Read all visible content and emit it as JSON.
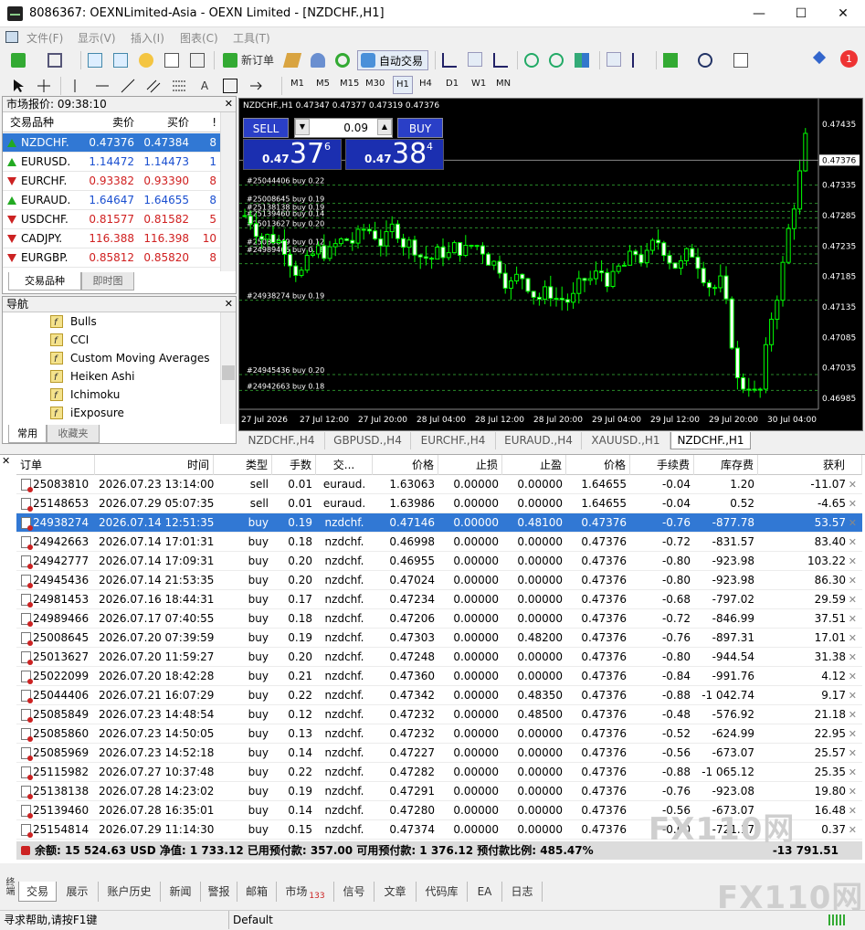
{
  "window": {
    "title": "8086367: OEXNLimited-Asia - OEXN Limited - [NZDCHF.,H1]",
    "min": "—",
    "max": "☐",
    "close": "✕"
  },
  "menu": [
    "文件(F)",
    "显示(V)",
    "插入(I)",
    "图表(C)",
    "工具(T)"
  ],
  "toolbar": {
    "new_order": "新订单",
    "autotrade": "自动交易",
    "timeframes": [
      "M1",
      "M5",
      "M15",
      "M30",
      "H1",
      "H4",
      "D1",
      "W1",
      "MN"
    ],
    "active_tf": "H1",
    "notif_count": "1"
  },
  "market_watch": {
    "title": "市场报价: 09:38:10",
    "headers": {
      "symbol": "交易品种",
      "bid": "卖价",
      "ask": "买价",
      "spread": "!"
    },
    "rows": [
      {
        "symbol": "NZDCHF.",
        "bid": "0.47376",
        "ask": "0.47384",
        "spread": "8",
        "dir": "up",
        "sel": true
      },
      {
        "symbol": "EURUSD.",
        "bid": "1.14472",
        "ask": "1.14473",
        "spread": "1",
        "dir": "up"
      },
      {
        "symbol": "EURCHF.",
        "bid": "0.93382",
        "ask": "0.93390",
        "spread": "8",
        "dir": "down"
      },
      {
        "symbol": "EURAUD.",
        "bid": "1.64647",
        "ask": "1.64655",
        "spread": "8",
        "dir": "up"
      },
      {
        "symbol": "USDCHF.",
        "bid": "0.81577",
        "ask": "0.81582",
        "spread": "5",
        "dir": "down"
      },
      {
        "symbol": "CADJPY.",
        "bid": "116.388",
        "ask": "116.398",
        "spread": "10",
        "dir": "down"
      },
      {
        "symbol": "EURGBP.",
        "bid": "0.85812",
        "ask": "0.85820",
        "spread": "8",
        "dir": "down"
      }
    ],
    "tabs": [
      "交易品种",
      "即时图"
    ]
  },
  "navigator": {
    "title": "导航",
    "items": [
      "Bulls",
      "CCI",
      "Custom Moving Averages",
      "Heiken Ashi",
      "Ichimoku",
      "iExposure"
    ],
    "tabs": [
      "常用",
      "收藏夹"
    ]
  },
  "chart": {
    "header": "NZDCHF.,H1  0.47347 0.47377 0.47319 0.47376",
    "sell": "SELL",
    "buy": "BUY",
    "lot": "0.09",
    "sell_small": "0.47",
    "sell_big": "37",
    "sell_sup": "6",
    "buy_small": "0.47",
    "buy_big": "38",
    "buy_sup": "4",
    "price_ticks": [
      "0.47435",
      "0.47376",
      "0.47335",
      "0.47285",
      "0.47235",
      "0.47185",
      "0.47135",
      "0.47085",
      "0.47035",
      "0.46985"
    ],
    "time_ticks": [
      "27 Jul 2026",
      "27 Jul 12:00",
      "27 Jul 20:00",
      "28 Jul 04:00",
      "28 Jul 12:00",
      "28 Jul 20:00",
      "29 Jul 04:00",
      "29 Jul 12:00",
      "29 Jul 20:00",
      "30 Jul 04:00"
    ],
    "order_labels": [
      "#25044406 buy 0.22",
      "#25008645 buy 0.19",
      "#25138138 buy 0.19",
      "#25139460 buy 0.14",
      "#25013627 buy 0.20",
      "#25085849 buy 0.12",
      "#24989466 buy 0.18",
      "#24938274 buy 0.19",
      "#24945436 buy 0.20",
      "#24942663 buy 0.18"
    ],
    "tabs": [
      "NZDCHF.,H4",
      "GBPUSD.,H4",
      "EURCHF.,H4",
      "EURAUD.,H4",
      "XAUUSD.,H1",
      "NZDCHF.,H1"
    ],
    "active_tab": "NZDCHF.,H1"
  },
  "terminal": {
    "headers": [
      "订单",
      "时间",
      "类型",
      "手数",
      "交...",
      "价格",
      "止损",
      "止盈",
      "价格",
      "手续费",
      "库存费",
      "获利"
    ],
    "rows": [
      [
        "25083810",
        "2026.07.23 13:14:00",
        "sell",
        "0.01",
        "euraud.",
        "1.63063",
        "0.00000",
        "0.00000",
        "1.64655",
        "-0.04",
        "1.20",
        "-11.07"
      ],
      [
        "25148653",
        "2026.07.29 05:07:35",
        "sell",
        "0.01",
        "euraud.",
        "1.63986",
        "0.00000",
        "0.00000",
        "1.64655",
        "-0.04",
        "0.52",
        "-4.65"
      ],
      [
        "24938274",
        "2026.07.14 12:51:35",
        "buy",
        "0.19",
        "nzdchf.",
        "0.47146",
        "0.00000",
        "0.48100",
        "0.47376",
        "-0.76",
        "-877.78",
        "53.57"
      ],
      [
        "24942663",
        "2026.07.14 17:01:31",
        "buy",
        "0.18",
        "nzdchf.",
        "0.46998",
        "0.00000",
        "0.00000",
        "0.47376",
        "-0.72",
        "-831.57",
        "83.40"
      ],
      [
        "24942777",
        "2026.07.14 17:09:31",
        "buy",
        "0.20",
        "nzdchf.",
        "0.46955",
        "0.00000",
        "0.00000",
        "0.47376",
        "-0.80",
        "-923.98",
        "103.22"
      ],
      [
        "24945436",
        "2026.07.14 21:53:35",
        "buy",
        "0.20",
        "nzdchf.",
        "0.47024",
        "0.00000",
        "0.00000",
        "0.47376",
        "-0.80",
        "-923.98",
        "86.30"
      ],
      [
        "24981453",
        "2026.07.16 18:44:31",
        "buy",
        "0.17",
        "nzdchf.",
        "0.47234",
        "0.00000",
        "0.00000",
        "0.47376",
        "-0.68",
        "-797.02",
        "29.59"
      ],
      [
        "24989466",
        "2026.07.17 07:40:55",
        "buy",
        "0.18",
        "nzdchf.",
        "0.47206",
        "0.00000",
        "0.00000",
        "0.47376",
        "-0.72",
        "-846.99",
        "37.51"
      ],
      [
        "25008645",
        "2026.07.20 07:39:59",
        "buy",
        "0.19",
        "nzdchf.",
        "0.47303",
        "0.00000",
        "0.48200",
        "0.47376",
        "-0.76",
        "-897.31",
        "17.01"
      ],
      [
        "25013627",
        "2026.07.20 11:59:27",
        "buy",
        "0.20",
        "nzdchf.",
        "0.47248",
        "0.00000",
        "0.00000",
        "0.47376",
        "-0.80",
        "-944.54",
        "31.38"
      ],
      [
        "25022099",
        "2026.07.20 18:42:28",
        "buy",
        "0.21",
        "nzdchf.",
        "0.47360",
        "0.00000",
        "0.00000",
        "0.47376",
        "-0.84",
        "-991.76",
        "4.12"
      ],
      [
        "25044406",
        "2026.07.21 16:07:29",
        "buy",
        "0.22",
        "nzdchf.",
        "0.47342",
        "0.00000",
        "0.48350",
        "0.47376",
        "-0.88",
        "-1 042.74",
        "9.17"
      ],
      [
        "25085849",
        "2026.07.23 14:48:54",
        "buy",
        "0.12",
        "nzdchf.",
        "0.47232",
        "0.00000",
        "0.48500",
        "0.47376",
        "-0.48",
        "-576.92",
        "21.18"
      ],
      [
        "25085860",
        "2026.07.23 14:50:05",
        "buy",
        "0.13",
        "nzdchf.",
        "0.47232",
        "0.00000",
        "0.00000",
        "0.47376",
        "-0.52",
        "-624.99",
        "22.95"
      ],
      [
        "25085969",
        "2026.07.23 14:52:18",
        "buy",
        "0.14",
        "nzdchf.",
        "0.47227",
        "0.00000",
        "0.00000",
        "0.47376",
        "-0.56",
        "-673.07",
        "25.57"
      ],
      [
        "25115982",
        "2026.07.27 10:37:48",
        "buy",
        "0.22",
        "nzdchf.",
        "0.47282",
        "0.00000",
        "0.00000",
        "0.47376",
        "-0.88",
        "-1 065.12",
        "25.35"
      ],
      [
        "25138138",
        "2026.07.28 14:23:02",
        "buy",
        "0.19",
        "nzdchf.",
        "0.47291",
        "0.00000",
        "0.00000",
        "0.47376",
        "-0.76",
        "-923.08",
        "19.80"
      ],
      [
        "25139460",
        "2026.07.28 16:35:01",
        "buy",
        "0.14",
        "nzdchf.",
        "0.47280",
        "0.00000",
        "0.00000",
        "0.47376",
        "-0.56",
        "-673.07",
        "16.48"
      ],
      [
        "25154814",
        "2026.07.29 11:14:30",
        "buy",
        "0.15",
        "nzdchf.",
        "0.47374",
        "0.00000",
        "0.00000",
        "0.47376",
        "-0.60",
        "-721.17",
        "0.37"
      ]
    ],
    "summary": "余额: 15 524.63 USD  净值: 1 733.12  已用预付款: 357.00  可用预付款: 1 376.12  预付款比例: 485.47%",
    "summary_total": "-13 791.51",
    "tabs": [
      "交易",
      "展示",
      "账户历史",
      "新闻",
      "警报",
      "邮箱",
      "市场",
      "信号",
      "文章",
      "代码库",
      "EA",
      "日志"
    ],
    "market_badge": "133"
  },
  "statusbar": {
    "help": "寻求帮助,请按F1键",
    "profile": "Default"
  },
  "watermark": "FX110网",
  "colors": {
    "selected": "#3178d4",
    "chart_bg": "#000000",
    "candle": "#00ff00",
    "order_line": "#2a8a2a"
  }
}
